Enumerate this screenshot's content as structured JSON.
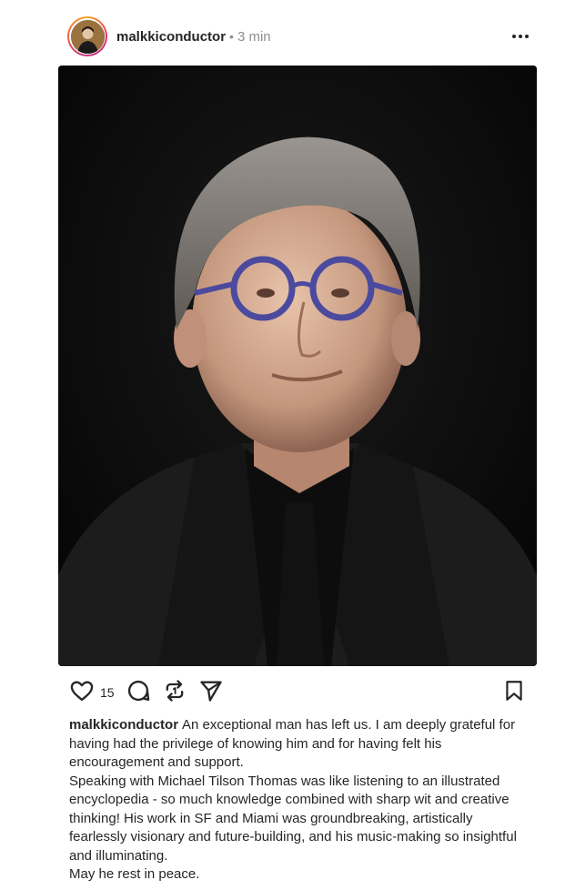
{
  "post": {
    "username": "malkkiconductor",
    "separator": "•",
    "time_ago": "3 min",
    "likes": "15",
    "caption_user": "malkkiconductor",
    "caption_lines": [
      "An exceptional man has left us. I am deeply grateful for having had the privilege of knowing him and for having felt his encouragement and support.",
      "Speaking with Michael Tilson Thomas was like listening to an illustrated encyclopedia - so much knowledge combined with sharp wit and creative thinking! His work in SF and Miami was groundbreaking, artistically fearlessly visionary and future-building, and his music-making so insightful and illuminating.",
      "May he rest in peace."
    ]
  },
  "icons": {
    "more": "more-options-icon",
    "like": "heart-icon",
    "comment": "comment-icon",
    "repost": "repost-icon",
    "share": "send-icon",
    "save": "bookmark-icon"
  },
  "colors": {
    "text": "#262626",
    "muted": "#8e8e8e",
    "photo_bg": "#0a0a0a"
  }
}
